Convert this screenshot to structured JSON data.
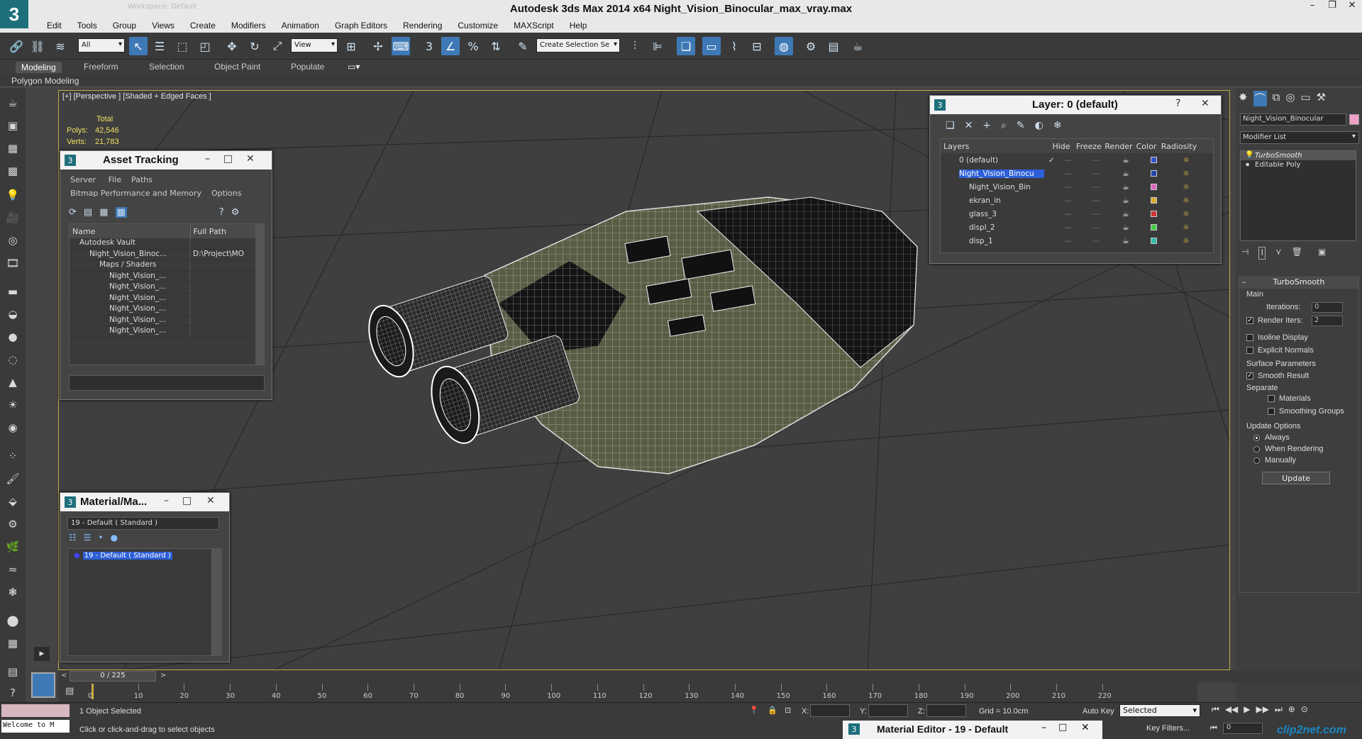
{
  "app": {
    "title": "Autodesk 3ds Max  2014 x64     Night_Vision_Binocular_max_vray.max",
    "logo": "3",
    "workspace": "Workspace: Default",
    "window_controls": [
      "–",
      "❐",
      "✕"
    ]
  },
  "menu": [
    "Edit",
    "Tools",
    "Group",
    "Views",
    "Create",
    "Modifiers",
    "Animation",
    "Graph Editors",
    "Rendering",
    "Customize",
    "MAXScript",
    "Help"
  ],
  "toolbar": {
    "selection_filter": "All",
    "reference_coord": "View",
    "named_selection": "Create Selection Se",
    "snap_3": "3",
    "angle_snap": "∠",
    "percent_snap": "%"
  },
  "ribbon": {
    "tabs": [
      "Modeling",
      "Freeform",
      "Selection",
      "Object Paint",
      "Populate"
    ],
    "active_tab": "Modeling",
    "panel_label": "Polygon Modeling"
  },
  "viewport": {
    "label": "[+] [Perspective ] [Shaded + Edged Faces ]",
    "stats": {
      "header": "Total",
      "polys_label": "Polys:",
      "polys": "42,546",
      "verts_label": "Verts:",
      "verts": "21,783"
    }
  },
  "asset_tracking": {
    "title": "Asset Tracking",
    "menu_row1": [
      "Server",
      "File",
      "Paths"
    ],
    "menu_row2": [
      "Bitmap Performance and Memory",
      "Options"
    ],
    "columns": [
      "Name",
      "Full Path"
    ],
    "rows": [
      {
        "name": "Autodesk Vault",
        "path": "",
        "indent": 1
      },
      {
        "name": "Night_Vision_Binoc...",
        "path": "D:\\Project\\MO",
        "indent": 2
      },
      {
        "name": "Maps / Shaders",
        "path": "",
        "indent": 3
      },
      {
        "name": "Night_Vision_...",
        "path": "",
        "indent": 4
      },
      {
        "name": "Night_Vision_...",
        "path": "",
        "indent": 4
      },
      {
        "name": "Night_Vision_...",
        "path": "",
        "indent": 4
      },
      {
        "name": "Night_Vision_...",
        "path": "",
        "indent": 4
      },
      {
        "name": "Night_Vision_...",
        "path": "",
        "indent": 4
      },
      {
        "name": "Night_Vision_...",
        "path": "",
        "indent": 4
      }
    ]
  },
  "material_map": {
    "title": "Material/Ma...",
    "field": "19 - Default  ( Standard )",
    "tree_item": "19 - Default  ( Standard )"
  },
  "layer_window": {
    "title": "Layer: 0 (default)",
    "help": "?",
    "columns": [
      "Layers",
      "Hide",
      "Freeze",
      "Render",
      "Color",
      "Radiosity"
    ],
    "rows": [
      {
        "name": "0 (default)",
        "color": "#3355cc",
        "selected": false,
        "indent": 0,
        "current": "✓"
      },
      {
        "name": "Night_Vision_Binocu",
        "color": "#2244aa",
        "selected": true,
        "indent": 0,
        "current": ""
      },
      {
        "name": "Night_Vision_Bin",
        "color": "#dd66bb",
        "selected": false,
        "indent": 1,
        "current": ""
      },
      {
        "name": "ekran_in",
        "color": "#ddaa33",
        "selected": false,
        "indent": 1,
        "current": ""
      },
      {
        "name": "glass_3",
        "color": "#cc3333",
        "selected": false,
        "indent": 1,
        "current": ""
      },
      {
        "name": "displ_2",
        "color": "#44cc44",
        "selected": false,
        "indent": 1,
        "current": ""
      },
      {
        "name": "disp_1",
        "color": "#33bbaa",
        "selected": false,
        "indent": 1,
        "current": ""
      }
    ]
  },
  "command_panel": {
    "object_name": "Night_Vision_Binocular",
    "object_color": "#f0a0c8",
    "modifier_list": "Modifier List",
    "stack": [
      "TurboSmooth",
      "Editable Poly"
    ],
    "rollout_title": "TurboSmooth",
    "main_label": "Main",
    "iterations_label": "Iterations:",
    "iterations": "0",
    "render_iters_label": "Render Iters:",
    "render_iters": "2",
    "isoline": "Isoline Display",
    "explicit_normals": "Explicit Normals",
    "surface_params": "Surface Parameters",
    "smooth_result": "Smooth Result",
    "separate": "Separate",
    "materials": "Materials",
    "smoothing_groups": "Smoothing Groups",
    "update_options": "Update Options",
    "always": "Always",
    "when_rendering": "When Rendering",
    "manually": "Manually",
    "update_button": "Update"
  },
  "timeline": {
    "frame": "0 / 225",
    "ticks": [
      "0",
      "10",
      "20",
      "30",
      "40",
      "50",
      "60",
      "70",
      "80",
      "90",
      "100",
      "110",
      "120",
      "130",
      "140",
      "150",
      "160",
      "170",
      "180",
      "190",
      "200",
      "210",
      "220"
    ]
  },
  "status": {
    "script_listener": "Welcome to M",
    "selected": "1 Object Selected",
    "prompt": "Click or click-and-drag to select objects",
    "x_label": "X:",
    "y_label": "Y:",
    "z_label": "Z:",
    "grid": "Grid = 10.0cm",
    "auto_key": "Auto Key",
    "set_key_filter": "Selected",
    "key_filters": "Key Filters...",
    "frame_field": "0",
    "mat_editor_title": "Material Editor - 19 - Default",
    "watermark": "clip2net.com"
  }
}
